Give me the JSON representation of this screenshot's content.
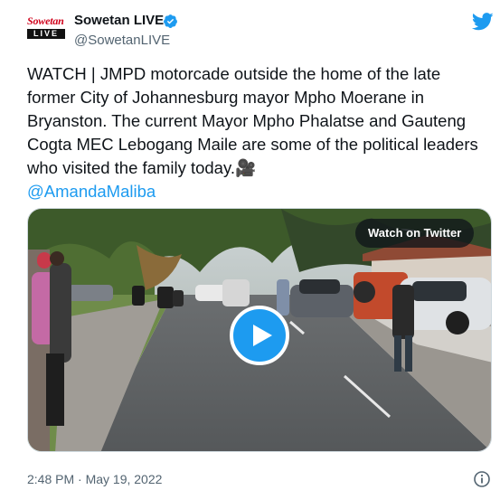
{
  "author": {
    "display_name": "Sowetan LIVE",
    "handle": "@SowetanLIVE",
    "logo_top": "Sowetan",
    "logo_bottom": "LIVE"
  },
  "tweet": {
    "text": "WATCH | JMPD motorcade outside the home of the late former City of Johannesburg mayor Mpho Moerane in Bryanston. The current Mayor Mpho Phalatse and Gauteng Cogta MEC Lebogang Maile are some of the political leaders who visited the family today.🎥",
    "mention": "@AmandaMaliba",
    "timestamp": "2:48 PM · May 19, 2022"
  },
  "media": {
    "badge_label": "Watch on Twitter",
    "type": "video"
  },
  "colors": {
    "accent": "#1d9bf0",
    "text": "#0f1419",
    "secondary": "#536471",
    "logo_red": "#d0021b"
  },
  "icons": [
    "verified-badge-icon",
    "twitter-bird-icon",
    "play-icon",
    "info-icon"
  ]
}
